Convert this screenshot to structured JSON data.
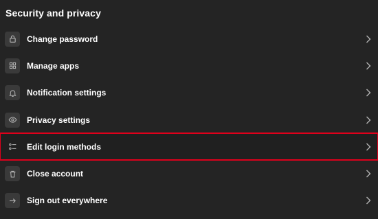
{
  "section": {
    "title": "Security and privacy"
  },
  "menu": {
    "items": [
      {
        "label": "Change password",
        "icon": "lock-icon"
      },
      {
        "label": "Manage apps",
        "icon": "apps-grid-icon"
      },
      {
        "label": "Notification settings",
        "icon": "bell-icon"
      },
      {
        "label": "Privacy settings",
        "icon": "eye-icon"
      },
      {
        "label": "Edit login methods",
        "icon": "list-icon",
        "highlighted": true
      },
      {
        "label": "Close account",
        "icon": "trash-icon"
      },
      {
        "label": "Sign out everywhere",
        "icon": "arrow-right-icon"
      }
    ]
  },
  "colors": {
    "background": "#242424",
    "icon_box": "#3a3a3a",
    "highlight_border": "#e0001b",
    "text": "#ffffff",
    "chevron": "#b3b3b3"
  }
}
